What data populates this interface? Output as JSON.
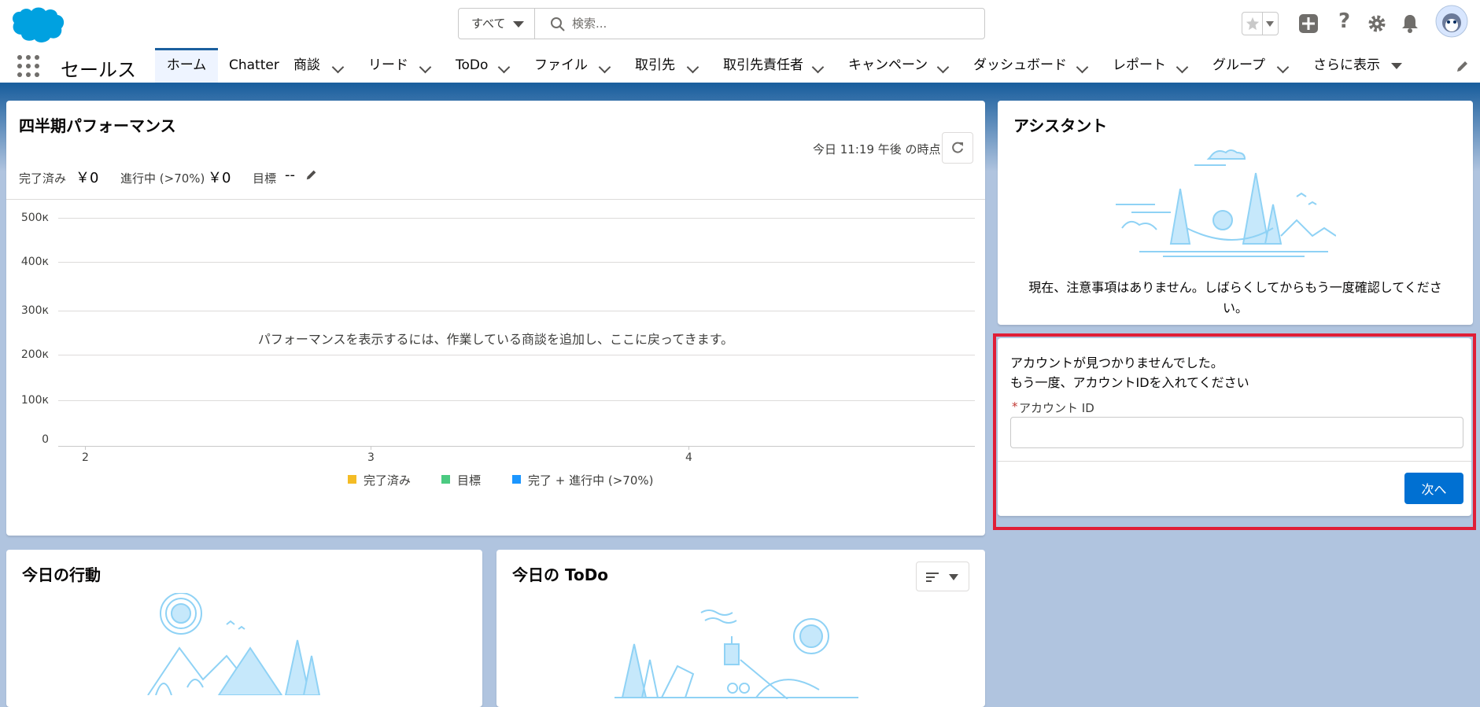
{
  "header": {
    "search_scope": "すべて",
    "search_placeholder": "検索..."
  },
  "nav": {
    "app_name": "セールス",
    "tabs": [
      {
        "label": "ホーム"
      },
      {
        "label": "Chatter"
      },
      {
        "label": "商談"
      },
      {
        "label": "リード"
      },
      {
        "label": "ToDo"
      },
      {
        "label": "ファイル"
      },
      {
        "label": "取引先"
      },
      {
        "label": "取引先責任者"
      },
      {
        "label": "キャンペーン"
      },
      {
        "label": "ダッシュボード"
      },
      {
        "label": "レポート"
      },
      {
        "label": "グループ"
      },
      {
        "label": "さらに表示"
      }
    ]
  },
  "performance": {
    "title": "四半期パフォーマンス",
    "as_of": "今日 11:19 午後 の時点",
    "closed_label": "完了済み",
    "closed_value": "￥0",
    "open_label": "進行中 (>70%)",
    "open_value": "￥0",
    "goal_label": "目標",
    "goal_value": "--",
    "empty_message": "パフォーマンスを表示するには、作業している商談を追加し、ここに戻ってきます。",
    "chart_data": {
      "type": "line",
      "x": [
        "2",
        "3",
        "4"
      ],
      "yticks": [
        "500к",
        "400к",
        "300к",
        "200к",
        "100к",
        "0"
      ],
      "ylim": [
        0,
        500000
      ],
      "series": [
        {
          "name": "完了済み",
          "color": "#f4bc25",
          "values": []
        },
        {
          "name": "目標",
          "color": "#4bca81",
          "values": []
        },
        {
          "name": "完了 + 進行中 (>70%)",
          "color": "#1b96ff",
          "values": []
        }
      ],
      "grid": true,
      "legend": "bottom"
    }
  },
  "assistant": {
    "title": "アシスタント",
    "message_line1": "現在、注意事項はありません。しばらくしてからもう一度確認してくださ",
    "message_line2": "い。"
  },
  "account_form": {
    "line1": "アカウントが見つかりませんでした。",
    "line2": "もう一度、アカウントIDを入れてください",
    "required_mark": "*",
    "field_label": "アカウント ID",
    "field_value": "",
    "next_button": "次へ",
    "highlight_color": "#e01e37"
  },
  "today_events": {
    "title": "今日の行動"
  },
  "today_todo": {
    "title": "今日の ToDo"
  },
  "colors": {
    "brand": "#0070d2",
    "nav_border": "#1b5f9e",
    "background": "#b0c4df"
  }
}
